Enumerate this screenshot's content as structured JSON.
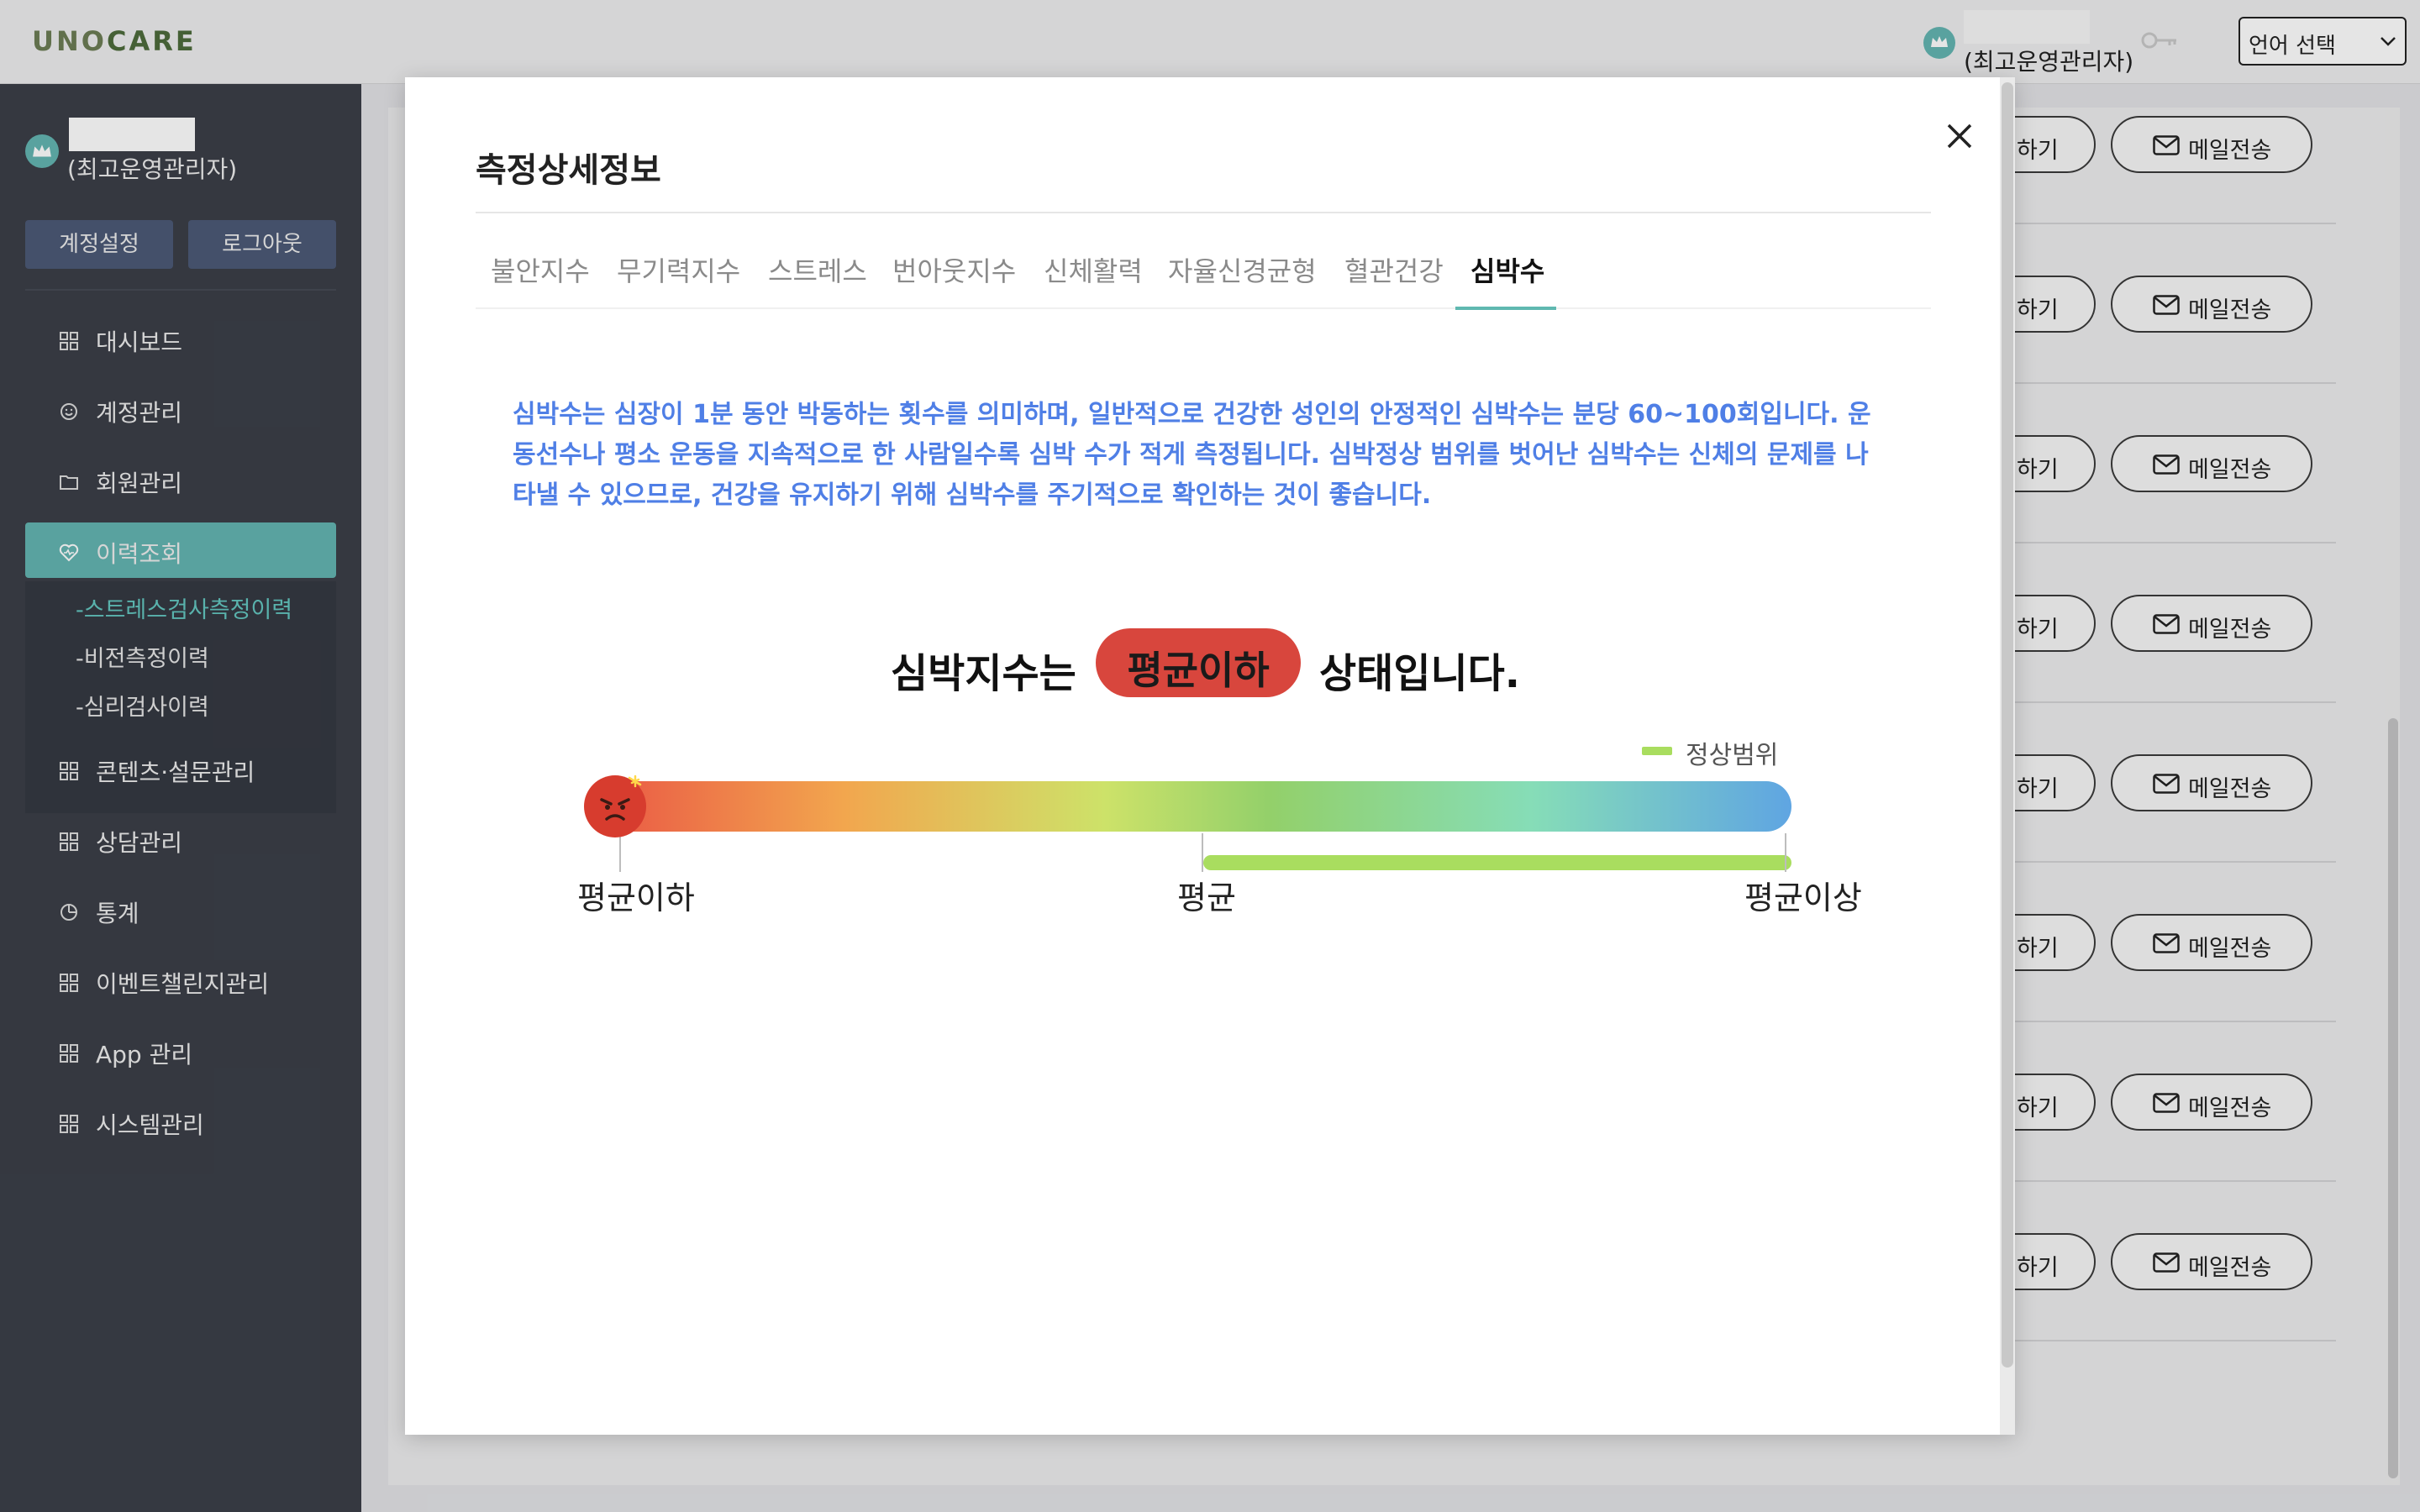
{
  "header": {
    "logo_part1": "UNO",
    "logo_part2": "CARE",
    "user_role": "(최고운영관리자)",
    "language_select": "언어 선택",
    "crown_icon": "crown-icon",
    "key_icon": "key-icon"
  },
  "sidebar": {
    "user_role": "(최고운영관리자)",
    "account_settings_label": "계정설정",
    "logout_label": "로그아웃",
    "menu": [
      {
        "label": "대시보드",
        "icon": "grid-icon"
      },
      {
        "label": "계정관리",
        "icon": "smile-icon"
      },
      {
        "label": "회원관리",
        "icon": "folder-icon"
      },
      {
        "label": "이력조회",
        "icon": "heart-icon",
        "active": true
      },
      {
        "label": "콘텐츠·설문관리",
        "icon": "grid-icon"
      },
      {
        "label": "상담관리",
        "icon": "grid-icon"
      },
      {
        "label": "통계",
        "icon": "chart-icon"
      },
      {
        "label": "이벤트챌린지관리",
        "icon": "grid-icon"
      },
      {
        "label": "App 관리",
        "icon": "grid-icon"
      },
      {
        "label": "시스템관리",
        "icon": "grid-icon"
      }
    ],
    "submenu": [
      {
        "label": "-스트레스검사측정이력",
        "active": true
      },
      {
        "label": "-비전측정이력"
      },
      {
        "label": "-심리검사이력"
      }
    ]
  },
  "background_rows": {
    "partial_button_label": "하기",
    "mail_button_label": "메일전송",
    "row_count": 8
  },
  "modal": {
    "title": "측정상세정보",
    "tabs": [
      "불안지수",
      "무기력지수",
      "스트레스",
      "번아웃지수",
      "신체활력",
      "자율신경균형",
      "혈관건강",
      "심박수"
    ],
    "active_tab": "심박수",
    "description": "심박수는 심장이 1분 동안 박동하는 횟수를 의미하며, 일반적으로 건강한 성인의 안정적인 심박수는 분당 60~100회입니다. 운동선수나 평소 운동을 지속적으로 한 사람일수록 심박 수가 적게 측정됩니다. 심박정상 범위를 벗어난 심박수는 신체의 문제를 나타낼 수 있으므로, 건강을 유지하기 위해 심박수를 주기적으로 확인하는 것이 좋습니다.",
    "status_prefix": "심박지수는",
    "status_value": "평균이하",
    "status_suffix": "상태입니다.",
    "legend_label": "정상범위",
    "gauge_labels": {
      "low": "평균이하",
      "mid": "평균",
      "high": "평균이상"
    },
    "gauge_position": 0,
    "normal_range": [
      0.5,
      1.0
    ],
    "colors": {
      "accent": "#64b5b1",
      "status_pill": "#d8463d",
      "description_text": "#4f7fe6",
      "normal_range": "#a9dd5f"
    }
  }
}
